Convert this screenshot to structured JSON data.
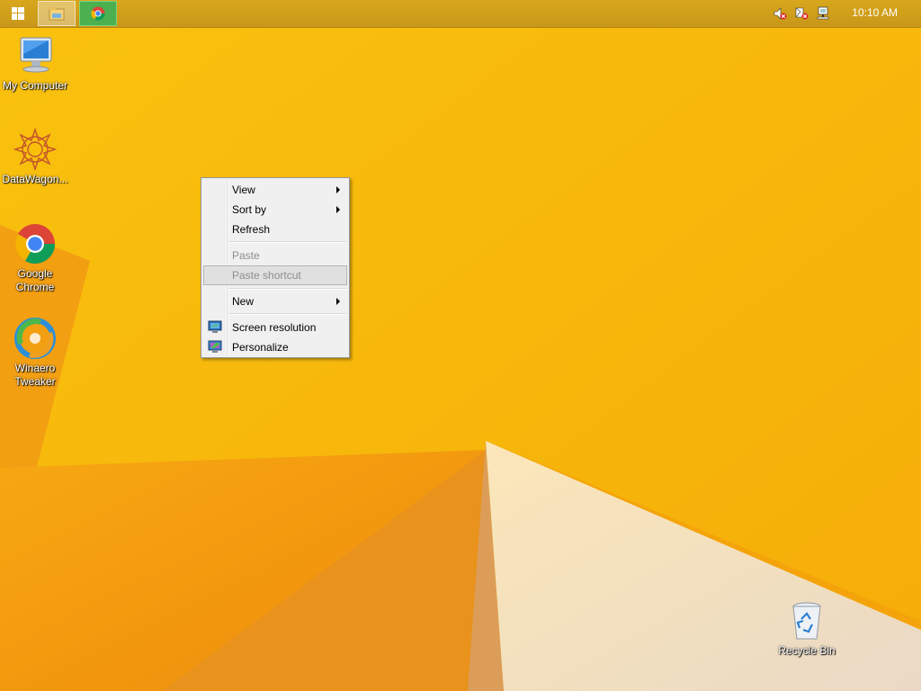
{
  "taskbar": {
    "clock": "10:10 AM"
  },
  "desktop_icons": [
    {
      "label": "My Computer",
      "icon": "computer-icon"
    },
    {
      "label": "DataWagon...",
      "icon": "datawagon-icon"
    },
    {
      "label": "Google Chrome",
      "icon": "chrome-icon"
    },
    {
      "label": "Winaero Tweaker",
      "icon": "winaero-tweaker-icon"
    },
    {
      "label": "Recycle Bin",
      "icon": "recycle-bin-icon"
    }
  ],
  "context_menu": {
    "items": [
      {
        "label": "View",
        "submenu": true,
        "enabled": true
      },
      {
        "label": "Sort by",
        "submenu": true,
        "enabled": true
      },
      {
        "label": "Refresh",
        "enabled": true
      },
      {
        "label": "Paste",
        "enabled": false
      },
      {
        "label": "Paste shortcut",
        "enabled": false,
        "highlighted": true
      },
      {
        "label": "New",
        "submenu": true,
        "enabled": true
      },
      {
        "label": "Screen resolution",
        "icon": "screen-resolution-icon",
        "enabled": true
      },
      {
        "label": "Personalize",
        "icon": "personalize-icon",
        "enabled": true
      }
    ]
  },
  "colors": {
    "wallpaper_yellow": "#f6b70a",
    "wallpaper_orange": "#f08a10",
    "wallpaper_cream": "#f2e6d2",
    "taskbar": "#d0a01b"
  }
}
